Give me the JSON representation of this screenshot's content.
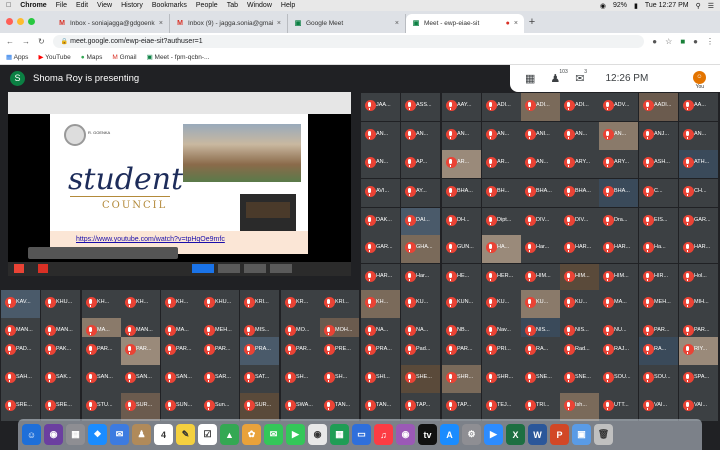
{
  "menubar": {
    "app": "Chrome",
    "items": [
      "File",
      "Edit",
      "View",
      "History",
      "Bookmarks",
      "People",
      "Tab",
      "Window",
      "Help"
    ],
    "battery": "92%",
    "time": "Tue 12:27 PM"
  },
  "tabs": [
    {
      "icon": "gmail-icon",
      "title": "Inbox - soniajagga@gdgoenka",
      "color": "#d93025"
    },
    {
      "icon": "gmail-icon",
      "title": "Inbox (9) - jagga.sonia@gmail",
      "color": "#d93025"
    },
    {
      "icon": "meet-icon",
      "title": "Google Meet",
      "color": "#0b8043"
    },
    {
      "icon": "meet-icon",
      "title": "Meet - ewp-eiae-sit",
      "color": "#0b8043",
      "active": true
    }
  ],
  "address": {
    "url": "meet.google.com/ewp-eiae-sit?authuser=1"
  },
  "bookmarks": [
    "Apps",
    "YouTube",
    "Maps",
    "Gmail",
    "Meet - fpm-qcbn-..."
  ],
  "meet": {
    "presenter_initial": "S",
    "presenting_text": "Shoma Roy is presenting",
    "people_count": "103",
    "chat_count": "3",
    "clock": "12:26  PM",
    "you_label": "You"
  },
  "presentation": {
    "logo_text": "R. GOENKA",
    "slide_title": "student",
    "slide_subtitle": "COUNCIL",
    "link": "https://www.youtube.com/watch?v=tpHqOe9mfc"
  },
  "participants": [
    "JAA...",
    "ASS...",
    "AAY...",
    "ADI...",
    "ADI...",
    "ADI...",
    "ADV...",
    "AADI...",
    "AA...",
    "AN...",
    "AN...",
    "AN...",
    "AN...",
    "ANI...",
    "AN...",
    "AN...",
    "ANJ...",
    "AN...",
    "AN...",
    "AP...",
    "AR...",
    "AR...",
    "AN...",
    "ARY...",
    "ARY...",
    "ASH...",
    "ATH...",
    "AVI...",
    "AY...",
    "BHA...",
    "BH...",
    "BHA...",
    "BHA...",
    "BHA...",
    "C...",
    "CH...",
    "DAK...",
    "DAI...",
    "DH...",
    "Dipt...",
    "DIV...",
    "DIV...",
    "Dra...",
    "EIS...",
    "GAR...",
    "GAR...",
    "GHA...",
    "GUN...",
    "HA...",
    "Har...",
    "HAR...",
    "HAR...",
    "Ha...",
    "HAR...",
    "HAR...",
    "Har...",
    "HE...",
    "HER...",
    "HIM...",
    "HIM...",
    "HIM...",
    "HIR...",
    "Hol...",
    "ISH...",
    "ISH...",
    "ISHI...",
    "JAA...",
    "JDY...",
    "JUN...",
    "Jyoti...",
    "KAR...",
    "KAT...",
    "KAV...",
    "KHU...",
    "KH...",
    "KH...",
    "KH...",
    "KHU...",
    "KRI...",
    "KR...",
    "KRI...",
    "KH...",
    "KU...",
    "KUN...",
    "KU...",
    "KU...",
    "KU...",
    "MA...",
    "MEH...",
    "MIH...",
    "MAN...",
    "MAN...",
    "MA...",
    "MAN...",
    "MA...",
    "MEH...",
    "MIS...",
    "MO...",
    "MOH...",
    "NA...",
    "NA...",
    "NB...",
    "Nav...",
    "NIS...",
    "NIS...",
    "NU...",
    "PAR...",
    "PAR...",
    "PAD...",
    "PAK...",
    "PAR...",
    "PAR...",
    "PAR...",
    "PAR...",
    "PRA...",
    "PAR...",
    "PRE...",
    "PRA...",
    "Pad...",
    "PAR...",
    "PRI...",
    "RA...",
    "Rad...",
    "RAJ...",
    "RA...",
    "RIY...",
    "SAH...",
    "SAK...",
    "SAN...",
    "SAN...",
    "SAN...",
    "SAR...",
    "SAT...",
    "SH...",
    "SH...",
    "SHI...",
    "SHE...",
    "SHR...",
    "SHR...",
    "SNE...",
    "SNE...",
    "SOU...",
    "SOU...",
    "SPA...",
    "SRE...",
    "SRE...",
    "STU...",
    "SUR...",
    "SUN...",
    "Sun...",
    "SUR...",
    "SWA...",
    "TAN...",
    "TAN...",
    "TAP...",
    "TAP...",
    "TEJ...",
    "TRI...",
    "Ish...",
    "UTT...",
    "VAI...",
    "VAI...",
    "VAN...",
    "VAN...",
    "VAS...",
    "VAS...",
    "VAS...",
    "VEE...",
    "VIN...",
    "Yogi...",
    "YUV...",
    "ZAY...",
    "VAI..."
  ],
  "dock": [
    "Finder",
    "Siri",
    "Launchpad",
    "Safari",
    "Mail",
    "Contacts",
    "Calendar",
    "Notes",
    "Reminders",
    "Maps",
    "Photos",
    "Messages",
    "FaceTime",
    "Chrome",
    "Numbers",
    "Keynote",
    "Music",
    "Podcasts",
    "TV",
    "App Store",
    "Preferences",
    "Zoom",
    "Excel",
    "Word",
    "PowerPoint",
    "Preview",
    "Trash"
  ]
}
